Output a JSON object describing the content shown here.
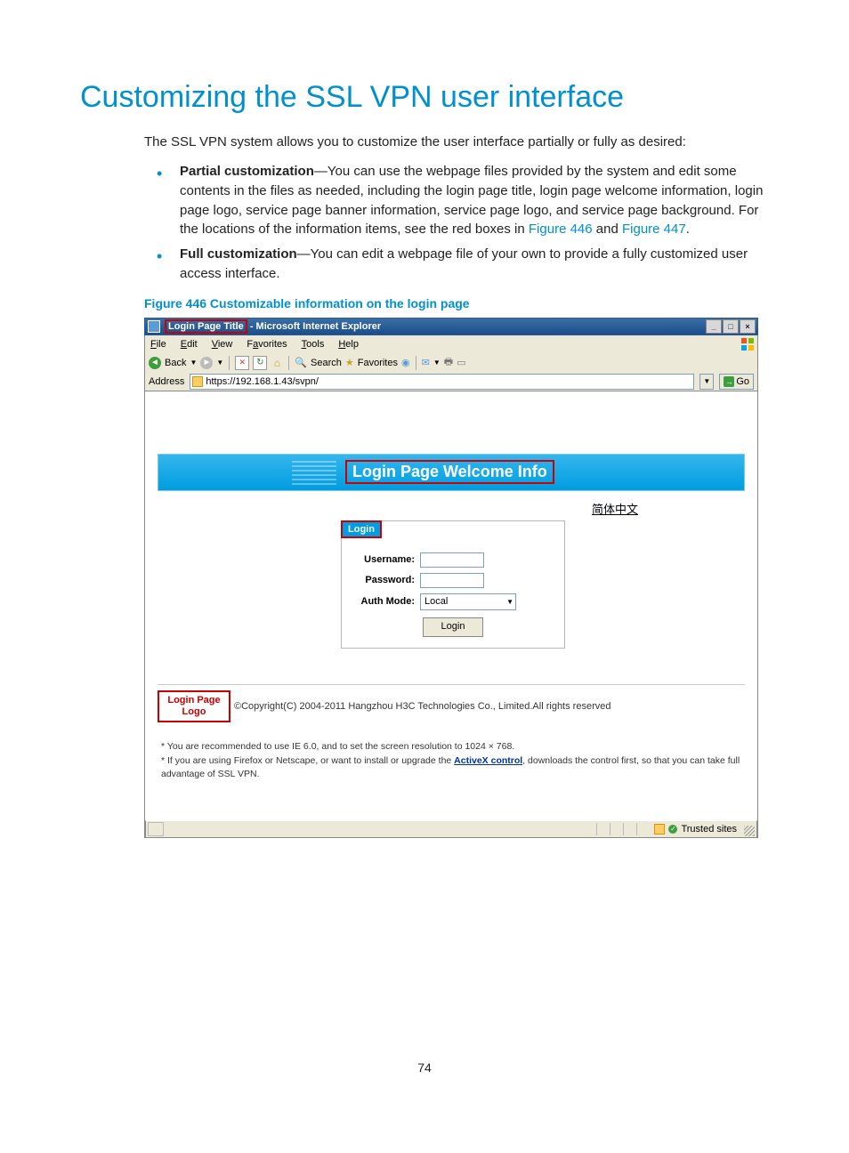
{
  "title": "Customizing the SSL VPN user interface",
  "intro": "The SSL VPN system allows you to customize the user interface partially or fully as desired:",
  "bullets": [
    {
      "strong": "Partial customization",
      "text_before_links": "—You can use the webpage files provided by the system and edit some contents in the files as needed, including the login page title, login page welcome information, login page logo, service page banner information, service page logo, and service page background. For the locations of the information items, see the red boxes in ",
      "link1": "Figure 446",
      "mid": " and ",
      "link2": "Figure 447",
      "tail": "."
    },
    {
      "strong": "Full customization",
      "text": "—You can edit a webpage file of your own to provide a fully customized user access interface."
    }
  ],
  "figure_caption": "Figure 446 Customizable information on the login page",
  "browser": {
    "title_highlight": "Login Page Title",
    "title_suffix": " - Microsoft Internet Explorer",
    "menus": {
      "file": "File",
      "edit": "Edit",
      "view": "View",
      "favorites": "Favorites",
      "tools": "Tools",
      "help": "Help"
    },
    "toolbar": {
      "back": "Back",
      "search": "Search",
      "favorites": "Favorites"
    },
    "address_label": "Address",
    "address_url": "https://192.168.1.43/svpn/",
    "go": "Go",
    "banner_welcome": "Login Page Welcome Info",
    "language_link": "简体中文",
    "login": {
      "header": "Login",
      "username_label": "Username:",
      "password_label": "Password:",
      "authmode_label": "Auth Mode:",
      "authmode_value": "Local",
      "button": "Login"
    },
    "logo_box": "Login Page Logo",
    "copyright": "©Copyright(C) 2004-2011 Hangzhou H3C Technologies Co., Limited.All rights reserved",
    "note1": "* You are recommended to use IE 6.0, and to set the screen resolution to 1024 × 768.",
    "note2a": "* If you are using Firefox or Netscape, or want to install or upgrade the ",
    "note2_link": "ActiveX control",
    "note2b": ", downloads the control first, so that you can take full advantage of SSL VPN.",
    "status_zone": "Trusted sites"
  },
  "page_number": "74"
}
